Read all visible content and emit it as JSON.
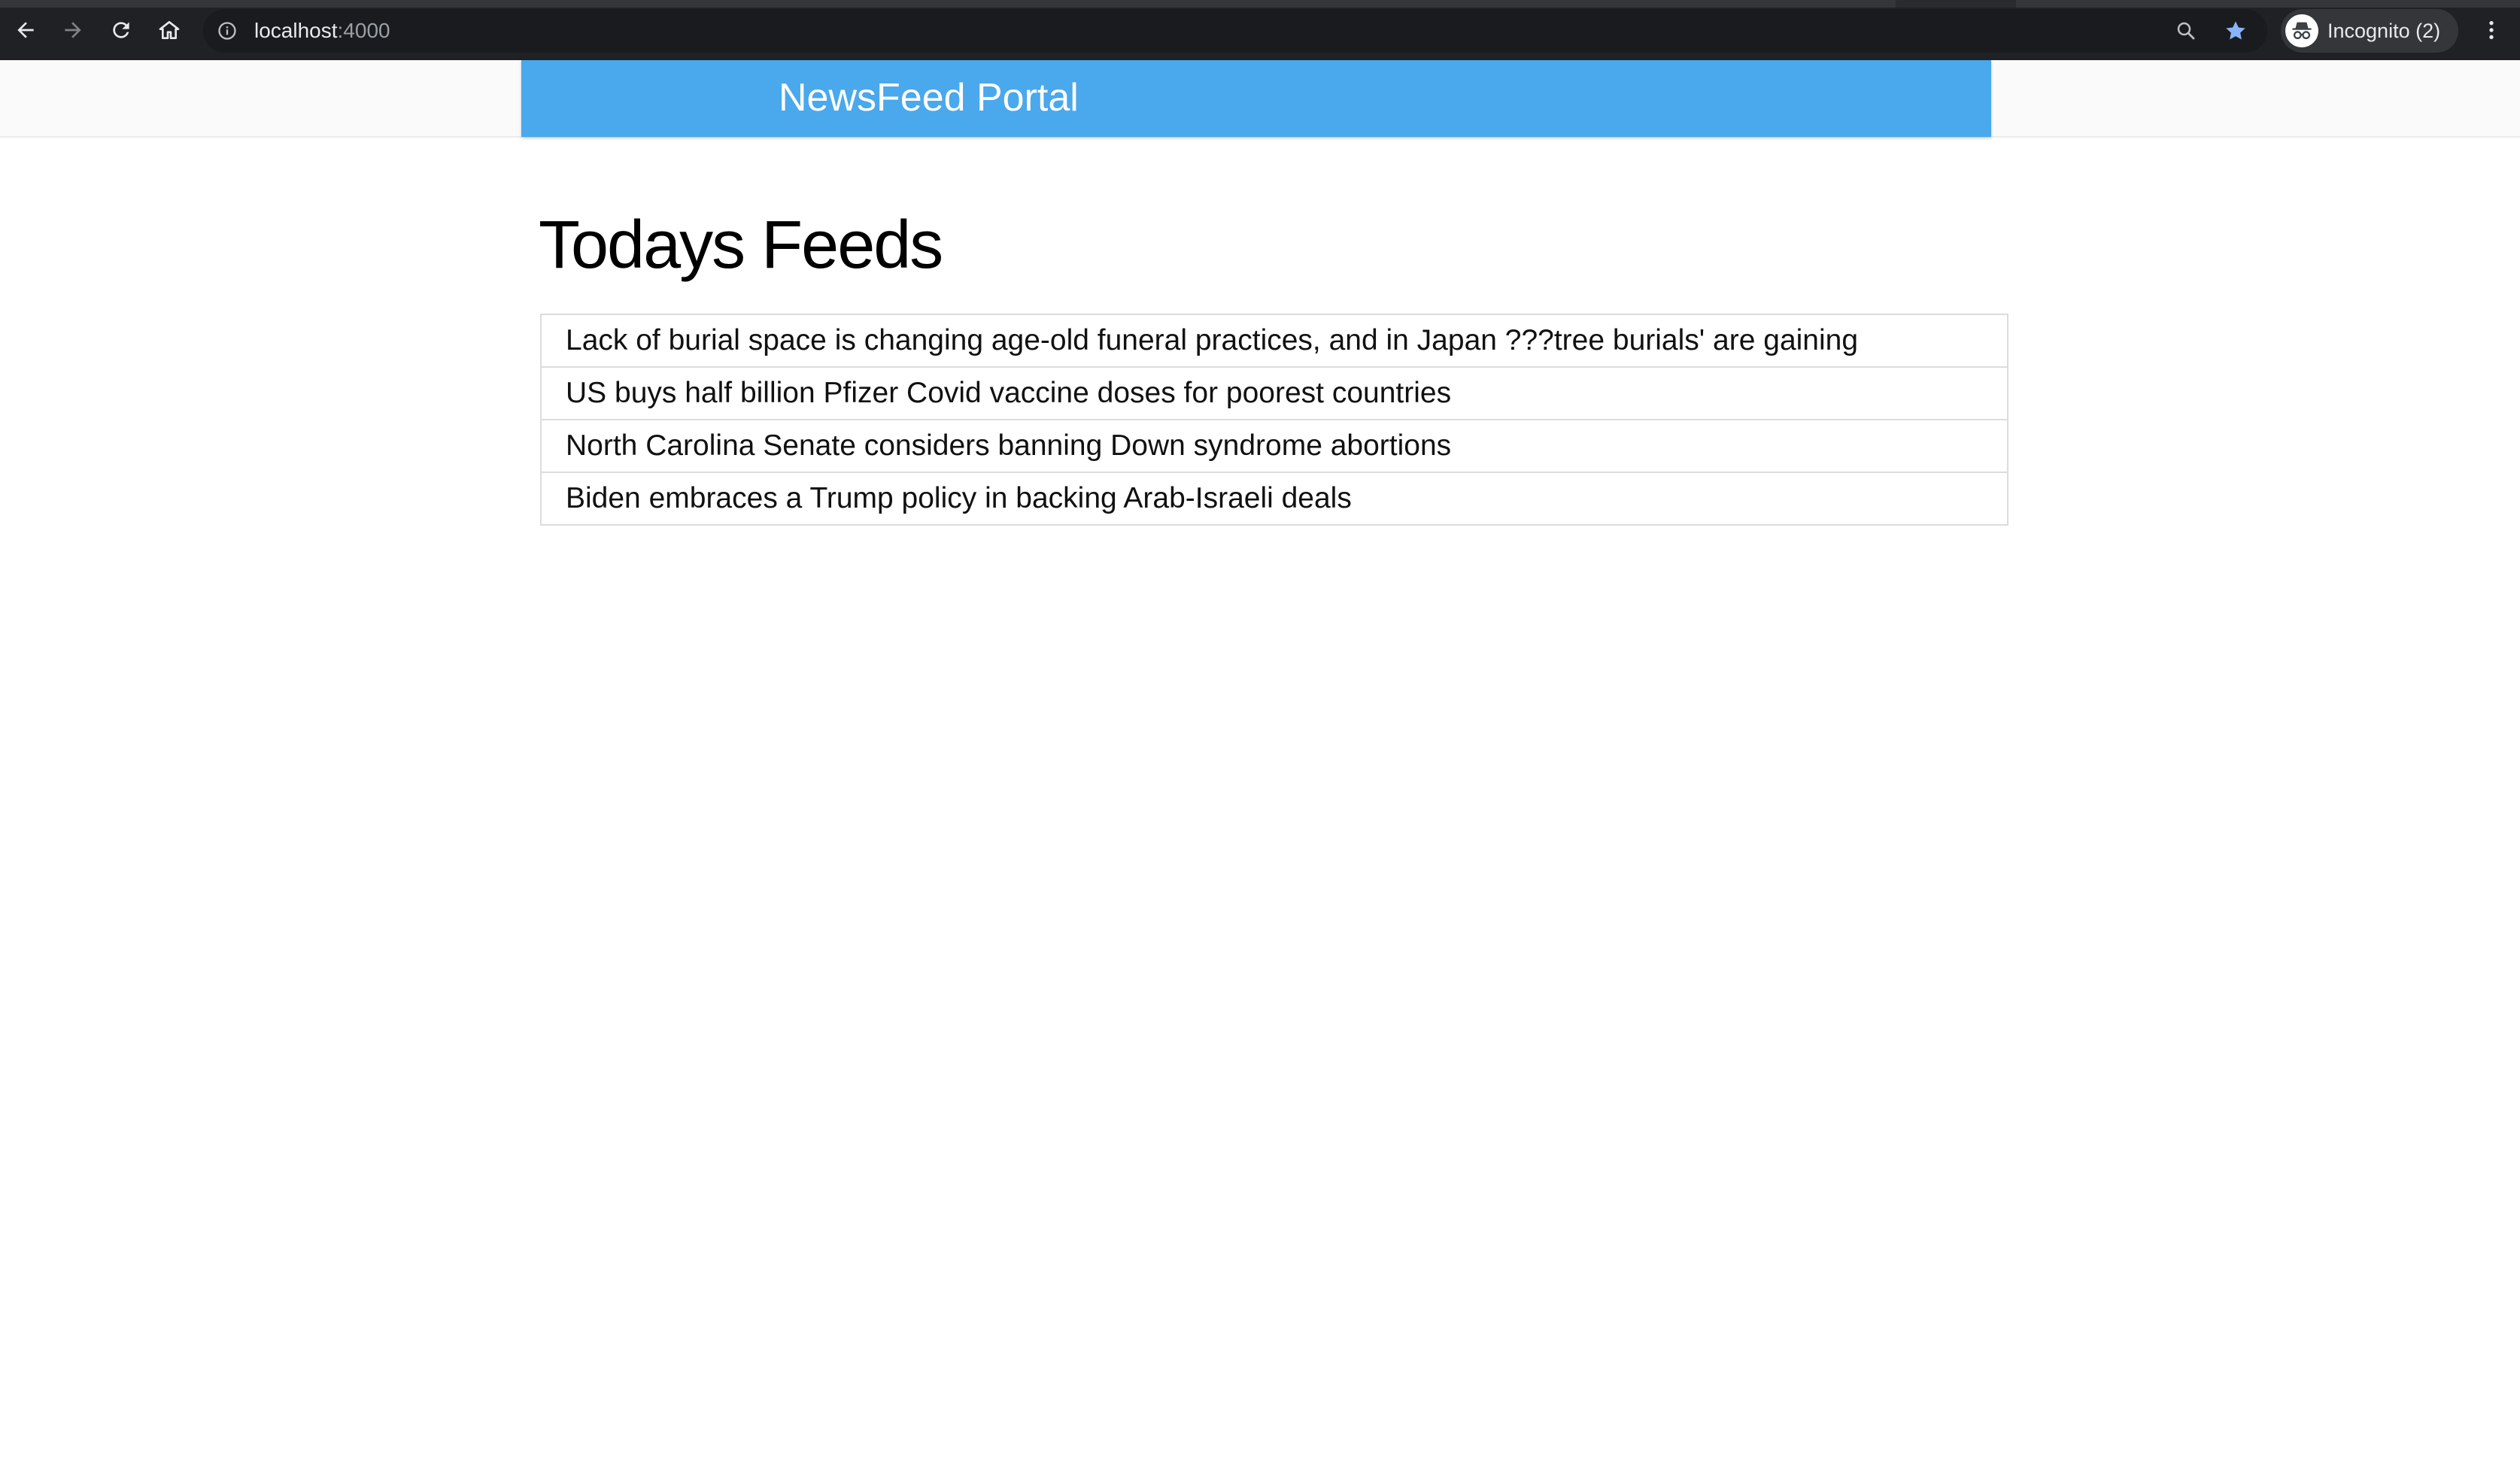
{
  "browser": {
    "url_host": "localhost",
    "url_port": ":4000",
    "profile_label": "Incognito (2)",
    "icons": {
      "back": "back-arrow-icon",
      "forward": "forward-arrow-icon",
      "reload": "reload-icon",
      "home": "home-icon",
      "site_info": "info-icon",
      "zoom": "zoom-magnifier-icon",
      "bookmark": "star-icon",
      "incognito": "incognito-icon",
      "menu": "kebab-menu-icon"
    },
    "colors": {
      "chrome_bg": "#202124",
      "bookmark_star": "#8ab4f8"
    }
  },
  "navbar": {
    "brand": "NewsFeed Portal",
    "color": "#4aa8ec"
  },
  "main": {
    "title": "Todays Feeds",
    "feeds": [
      "Lack of burial space is changing age-old funeral practices, and in Japan ???tree burials' are gaining",
      "US buys half billion Pfizer Covid vaccine doses for poorest countries",
      "North Carolina Senate considers banning Down syndrome abortions",
      "Biden embraces a Trump policy in backing Arab-Israeli deals"
    ]
  }
}
